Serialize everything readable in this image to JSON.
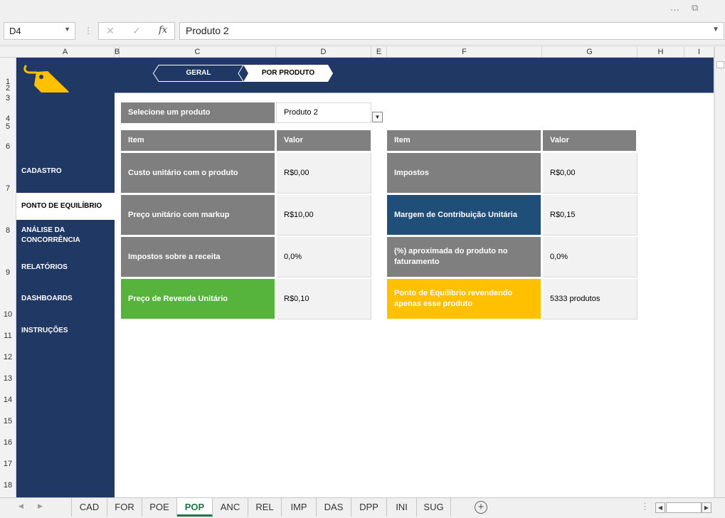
{
  "window": {
    "more_icon": "…",
    "restore_icon": "⧉"
  },
  "formula_bar": {
    "name_box": "D4",
    "cancel_icon": "✕",
    "enter_icon": "✓",
    "fx_label": "fx",
    "content": "Produto 2"
  },
  "columns": [
    "A",
    "B",
    "C",
    "D",
    "E",
    "F",
    "G",
    "H",
    "I"
  ],
  "rows": [
    "1",
    "2",
    "3",
    "4",
    "5",
    "6",
    "7",
    "8",
    "9",
    "10",
    "11",
    "12",
    "13",
    "14",
    "15",
    "16",
    "17",
    "18"
  ],
  "header_tabs": {
    "geral": "GERAL",
    "por_produto": "POR PRODUTO"
  },
  "sidebar": {
    "items": [
      {
        "label": "CADASTRO"
      },
      {
        "label": "PONTO DE EQUILÍBRIO"
      },
      {
        "label": "ANÁLISE DA CONCORRÊNCIA"
      },
      {
        "label": "RELATÓRIOS"
      },
      {
        "label": "DASHBOARDS"
      },
      {
        "label": "INSTRUÇÕES"
      }
    ]
  },
  "selector": {
    "label": "Selecione um produto",
    "value": "Produto 2"
  },
  "left_table": {
    "headers": {
      "item": "Item",
      "value": "Valor"
    },
    "rows": [
      {
        "item": "Custo unitário com o produto",
        "value": "R$0,00"
      },
      {
        "item": "Preço unitário com markup",
        "value": "R$10,00"
      },
      {
        "item": "Impostos sobre a receita",
        "value": "0,0%"
      },
      {
        "item": "Preço de Revenda Unitário",
        "value": "R$0,10"
      }
    ]
  },
  "right_table": {
    "headers": {
      "item": "Item",
      "value": "Valor"
    },
    "rows": [
      {
        "item": "Impostos",
        "value": "R$0,00"
      },
      {
        "item": "Margem de Contribuição Unitária",
        "value": "R$0,15"
      },
      {
        "item": "(%) aproximada do produto no faturamento",
        "value": "0,0%"
      },
      {
        "item": "Ponto de Equilíbrio revendendo apenas esse produto",
        "value": "5333 produtos"
      }
    ]
  },
  "sheet_tabs": [
    "CAD",
    "FOR",
    "POE",
    "POP",
    "ANC",
    "REL",
    "IMP",
    "DAS",
    "DPP",
    "INI",
    "SUG"
  ],
  "active_sheet": "POP",
  "colors": {
    "navy": "#1f3864",
    "green": "#56b33c",
    "blue": "#1f4e79",
    "gold": "#ffc000",
    "gray": "#808080",
    "excel_green": "#217346"
  }
}
